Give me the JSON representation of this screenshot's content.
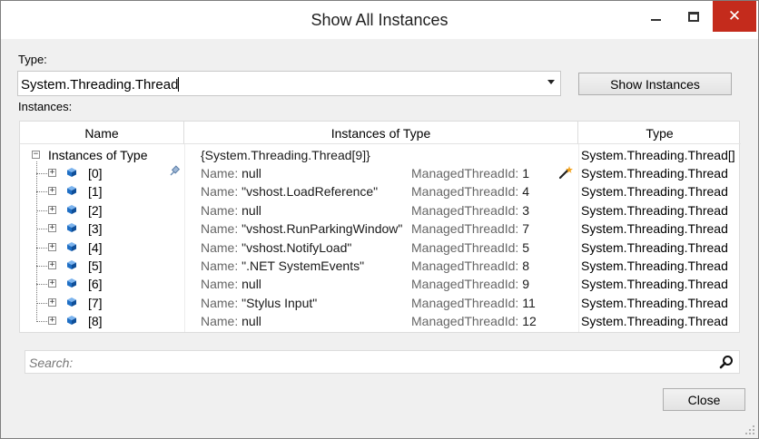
{
  "window": {
    "title": "Show All Instances"
  },
  "type_field": {
    "label": "Type:",
    "value": "System.Threading.Thread"
  },
  "show_instances_label": "Show Instances",
  "instances_label": "Instances:",
  "columns": {
    "name": "Name",
    "instances": "Instances of Type",
    "type": "Type"
  },
  "root": {
    "name": "Instances of Type",
    "value": "{System.Threading.Thread[9]}",
    "type": "System.Threading.Thread[]"
  },
  "rows": [
    {
      "name": "[0]",
      "name_label": "Name:",
      "name_value": "null",
      "mtid_label": "ManagedThreadId:",
      "mtid": "1",
      "type": "System.Threading.Thread"
    },
    {
      "name": "[1]",
      "name_label": "Name:",
      "name_value": "\"vshost.LoadReference\"",
      "mtid_label": "ManagedThreadId:",
      "mtid": "4",
      "type": "System.Threading.Thread"
    },
    {
      "name": "[2]",
      "name_label": "Name:",
      "name_value": "null",
      "mtid_label": "ManagedThreadId:",
      "mtid": "3",
      "type": "System.Threading.Thread"
    },
    {
      "name": "[3]",
      "name_label": "Name:",
      "name_value": "\"vshost.RunParkingWindow\"",
      "mtid_label": "ManagedThreadId:",
      "mtid": "7",
      "type": "System.Threading.Thread"
    },
    {
      "name": "[4]",
      "name_label": "Name:",
      "name_value": "\"vshost.NotifyLoad\"",
      "mtid_label": "ManagedThreadId:",
      "mtid": "5",
      "type": "System.Threading.Thread"
    },
    {
      "name": "[5]",
      "name_label": "Name:",
      "name_value": "\".NET SystemEvents\"",
      "mtid_label": "ManagedThreadId:",
      "mtid": "8",
      "type": "System.Threading.Thread"
    },
    {
      "name": "[6]",
      "name_label": "Name:",
      "name_value": "null",
      "mtid_label": "ManagedThreadId:",
      "mtid": "9",
      "type": "System.Threading.Thread"
    },
    {
      "name": "[7]",
      "name_label": "Name:",
      "name_value": "\"Stylus Input\"",
      "mtid_label": "ManagedThreadId:",
      "mtid": "11",
      "type": "System.Threading.Thread"
    },
    {
      "name": "[8]",
      "name_label": "Name:",
      "name_value": "null",
      "mtid_label": "ManagedThreadId:",
      "mtid": "12",
      "type": "System.Threading.Thread"
    }
  ],
  "search": {
    "placeholder": "Search:"
  },
  "close_label": "Close",
  "icons": {
    "expand": "plus-box-icon",
    "collapse": "minus-box-icon",
    "object": "blue-cube-icon",
    "pin": "pin-icon",
    "wand": "magic-wand-icon",
    "search": "magnifier-icon"
  },
  "colors": {
    "close_button": "#c42b1c",
    "cube": "#1f6fc5"
  }
}
